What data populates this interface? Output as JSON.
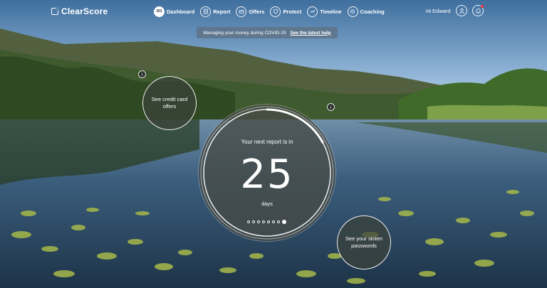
{
  "brand": {
    "name": "ClearScore"
  },
  "nav": {
    "items": [
      {
        "label": "Dashboard",
        "icon": "score-icon",
        "badge": "301"
      },
      {
        "label": "Report",
        "icon": "report-icon"
      },
      {
        "label": "Offers",
        "icon": "offers-icon"
      },
      {
        "label": "Protect",
        "icon": "protect-icon"
      },
      {
        "label": "Timeline",
        "icon": "timeline-icon"
      },
      {
        "label": "Coaching",
        "icon": "coaching-icon"
      }
    ],
    "greeting": "Hi Edward"
  },
  "banner": {
    "text": "Managing your money during COVID-19",
    "link": "See the latest help"
  },
  "widgets": {
    "credit_cards": "See credit card offers",
    "stolen_passwords": "See your stolen passwords",
    "info_glyph": "i"
  },
  "report": {
    "title": "Your next report is in",
    "value": "25",
    "unit": "days",
    "progress_fraction": 0.17,
    "pages": 8,
    "active_page": 8
  },
  "colors": {
    "accent": "#ffffff",
    "notification": "#e53935"
  }
}
